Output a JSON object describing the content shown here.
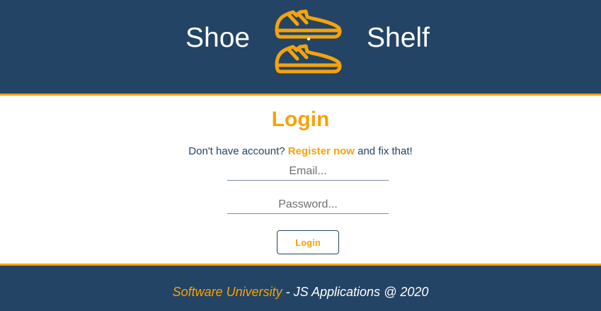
{
  "header": {
    "brand_left": "Shoe",
    "brand_right": "Shelf",
    "logo_icon": "sneakers-icon"
  },
  "login": {
    "title": "Login",
    "hint_prefix": "Don't have account?",
    "register_link": "Register now",
    "hint_suffix": "and fix that!",
    "email_placeholder": "Email...",
    "email_value": "",
    "password_placeholder": "Password...",
    "password_value": "",
    "submit_label": "Login"
  },
  "footer": {
    "org": "Software University",
    "rest": "- JS Applications @ 2020"
  },
  "colors": {
    "navy": "#234465",
    "accent": "#f5a30a",
    "white": "#ffffff"
  }
}
